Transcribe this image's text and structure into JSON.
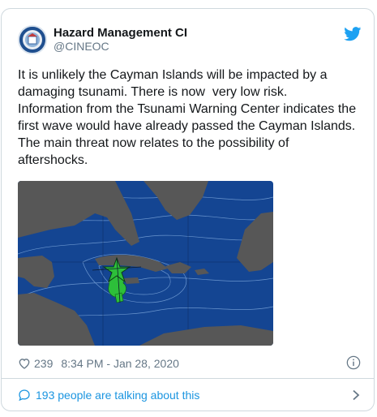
{
  "tweet": {
    "author_name": "Hazard Management CI",
    "author_handle": "@CINEOC",
    "text_lines": [
      "It is unlikely the Cayman Islands will be impacted by a damaging tsunami. There is now  very low risk.",
      "Information from the Tsunami Warning Center indicates the first wave would have already passed the Cayman Islands. The main threat now relates to the possibility of aftershocks."
    ],
    "likes": "239",
    "timestamp": "8:34 PM - Jan 28, 2020",
    "talking_about": "193 people are talking about this"
  },
  "icons": {
    "brand": "twitter-bird-icon",
    "like": "heart-icon",
    "info": "info-icon",
    "conversation": "speech-bubble-icon",
    "more": "chevron-right-icon"
  },
  "colors": {
    "link_blue": "#1b95e0",
    "twitter_blue": "#1da1f2",
    "text_primary": "#14171a",
    "text_secondary": "#657786",
    "border": "#cfd9de",
    "map_ocean": "#12408a",
    "map_land": "#555555",
    "epicenter_star": "#2dbf3a"
  }
}
